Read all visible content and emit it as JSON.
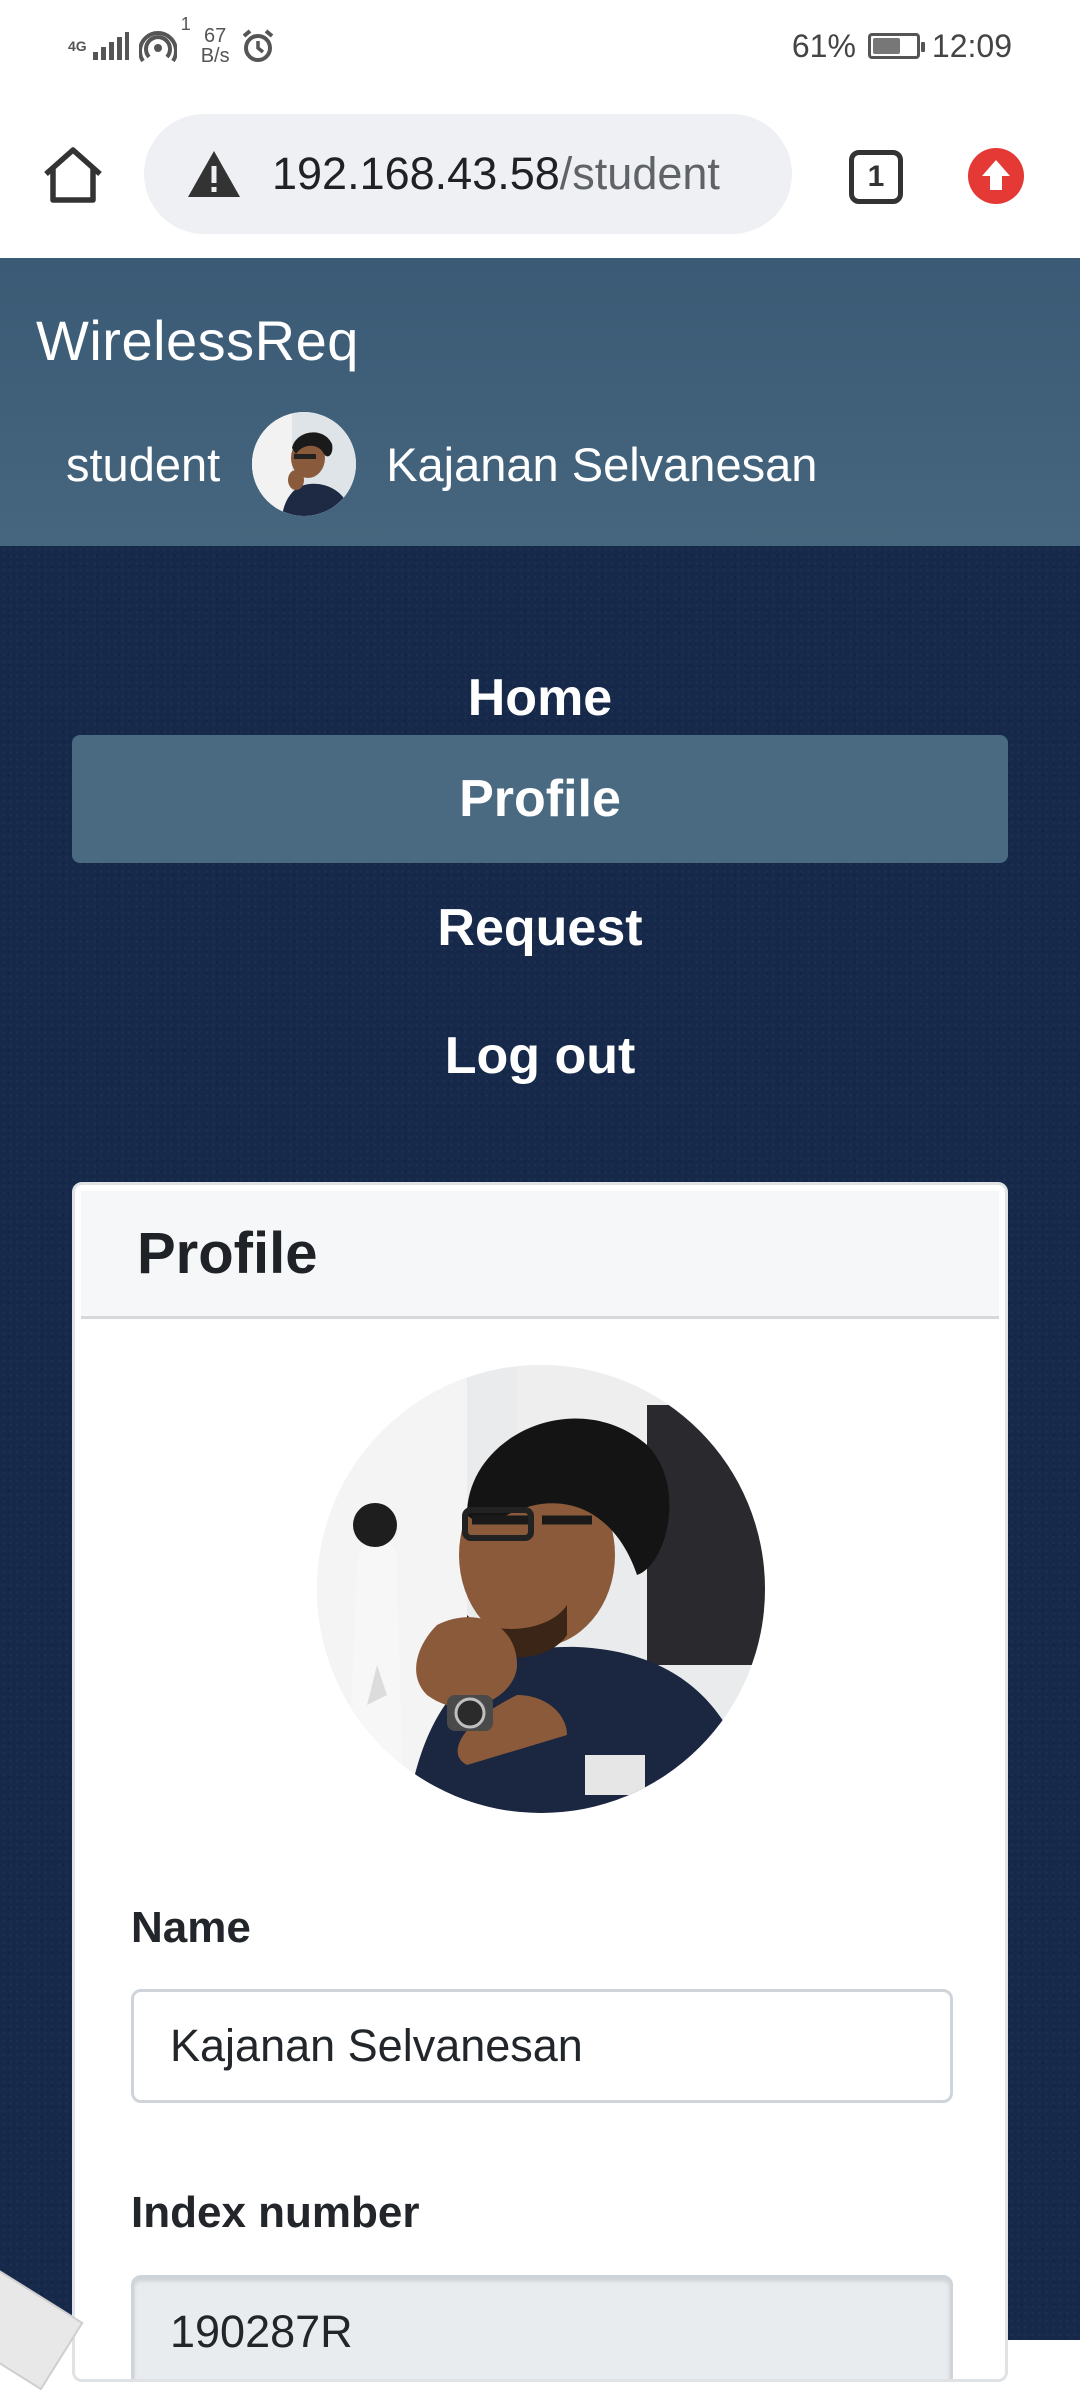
{
  "status_bar": {
    "network": "4G",
    "sim_index": "1",
    "speed_value": "67",
    "speed_unit": "B/s",
    "battery": "61%",
    "battery_level": 0.61,
    "time": "12:09",
    "icons": [
      "signal-icon",
      "hotspot-icon",
      "alarm-icon",
      "battery-icon"
    ]
  },
  "browser": {
    "url_host": "192.168.43.58",
    "url_path": "/student",
    "tab_count": "1",
    "icons": [
      "home-icon",
      "warning-icon",
      "tabs-icon",
      "update-icon"
    ],
    "accent": "#e53935"
  },
  "header": {
    "brand": "WirelessReq",
    "role": "student",
    "user_name": "Kajanan Selvanesan",
    "background": "#3e5e78"
  },
  "nav": {
    "items": [
      {
        "label": "Home",
        "active": false
      },
      {
        "label": "Profile",
        "active": true
      },
      {
        "label": "Request",
        "active": false
      },
      {
        "label": "Log out",
        "active": false
      }
    ]
  },
  "profile_card": {
    "title": "Profile",
    "fields": [
      {
        "label": "Name",
        "value": "Kajanan Selvanesan",
        "readonly": false
      },
      {
        "label": "Index number",
        "value": "190287R",
        "readonly": true
      }
    ]
  },
  "colors": {
    "page_background": "#16294a",
    "active_nav": "#4a6a82"
  }
}
